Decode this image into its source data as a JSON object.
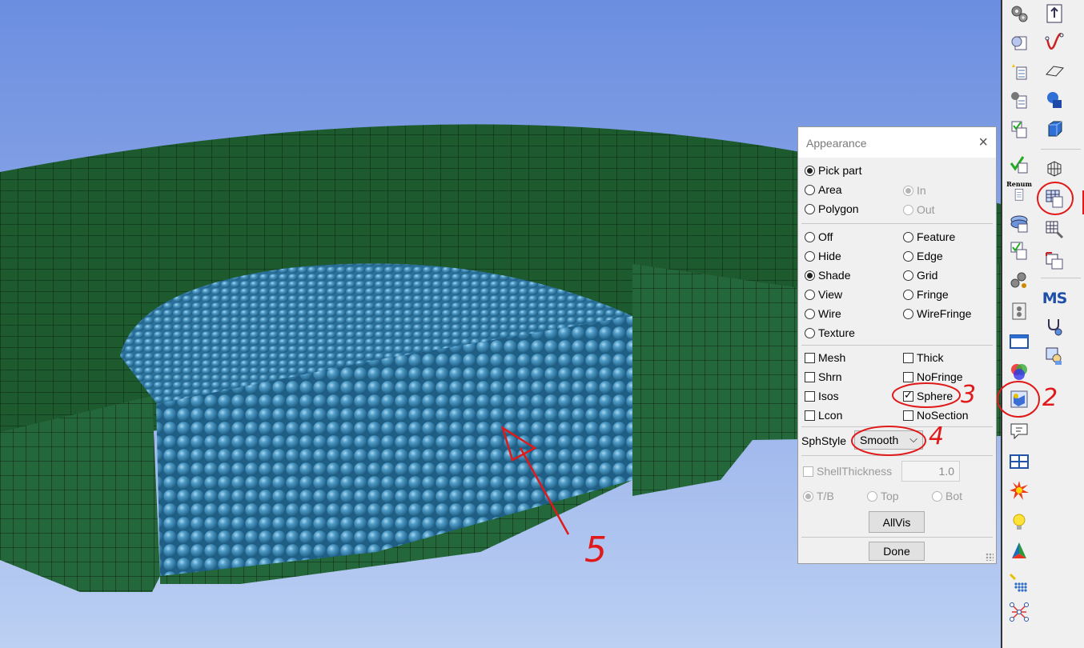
{
  "dialog": {
    "title": "Appearance",
    "close_glyph": "×",
    "select_mode": [
      {
        "label": "Pick part",
        "selected": true
      },
      {
        "label": "Area",
        "selected": false
      },
      {
        "label": "Polygon",
        "selected": false
      }
    ],
    "in_out": [
      {
        "label": "In",
        "selected": true,
        "disabled": true
      },
      {
        "label": "Out",
        "selected": false,
        "disabled": true
      }
    ],
    "display_left": [
      {
        "label": "Off",
        "selected": false
      },
      {
        "label": "Hide",
        "selected": false
      },
      {
        "label": "Shade",
        "selected": true
      },
      {
        "label": "View",
        "selected": false
      },
      {
        "label": "Wire",
        "selected": false
      },
      {
        "label": "Texture",
        "selected": false
      }
    ],
    "display_right": [
      {
        "label": "Feature",
        "selected": false
      },
      {
        "label": "Edge",
        "selected": false
      },
      {
        "label": "Grid",
        "selected": false
      },
      {
        "label": "Fringe",
        "selected": false
      },
      {
        "label": "WireFringe",
        "selected": false
      }
    ],
    "options_left": [
      {
        "label": "Mesh",
        "checked": false
      },
      {
        "label": "Shrn",
        "checked": false
      },
      {
        "label": "Isos",
        "checked": false
      },
      {
        "label": "Lcon",
        "checked": false
      }
    ],
    "options_right": [
      {
        "label": "Thick",
        "checked": false
      },
      {
        "label": "NoFringe",
        "checked": false
      },
      {
        "label": "Sphere",
        "checked": true
      },
      {
        "label": "NoSection",
        "checked": false
      }
    ],
    "sph_style_label": "SphStyle",
    "sph_style_value": "Smooth",
    "shell_thickness_label": "ShellThickness",
    "shell_thickness_value": "1.0",
    "shell_sides": [
      {
        "label": "T/B",
        "selected": true
      },
      {
        "label": "Top",
        "selected": false
      },
      {
        "label": "Bot",
        "selected": false
      }
    ],
    "allvis_label": "AllVis",
    "done_label": "Done"
  },
  "toolbar": {
    "left_column": [
      "gears-icon",
      "part-list-icon",
      "new-part-icon",
      "settings-list-icon",
      "check-list-icon",
      "check-list-2-icon",
      "renumber-icon",
      "layers-icon",
      "table-check-icon",
      "gear-group-icon",
      "module-icon",
      "window-icon",
      "color-wheel-icon",
      "appearance-sphere-icon",
      "message-icon",
      "split-view-icon",
      "explode-icon",
      "light-bulb-icon",
      "tripod-icon",
      "particle-grid-icon",
      "node-network-icon"
    ],
    "right_column": [
      "import-icon",
      "curve-icon",
      "plane-icon",
      "solid-icon",
      "box-icon",
      "lattice-icon",
      "part-table-icon",
      "grid-tool-icon",
      "list-edit-icon",
      "ms-icon",
      "stethoscope-icon",
      "inspect-icon"
    ],
    "renumber_text": "Renum",
    "ms_text": "MS"
  },
  "colors": {
    "mesh_green": "#1d5a2e",
    "sphere_blue": "#3a86b5",
    "annotation_red": "#e01a1a",
    "bg_top": "#6c8ee0",
    "bg_bottom": "#bcd0f3"
  },
  "annotations": {
    "n2": "2",
    "n3": "3",
    "n4": "4",
    "n5": "5"
  }
}
